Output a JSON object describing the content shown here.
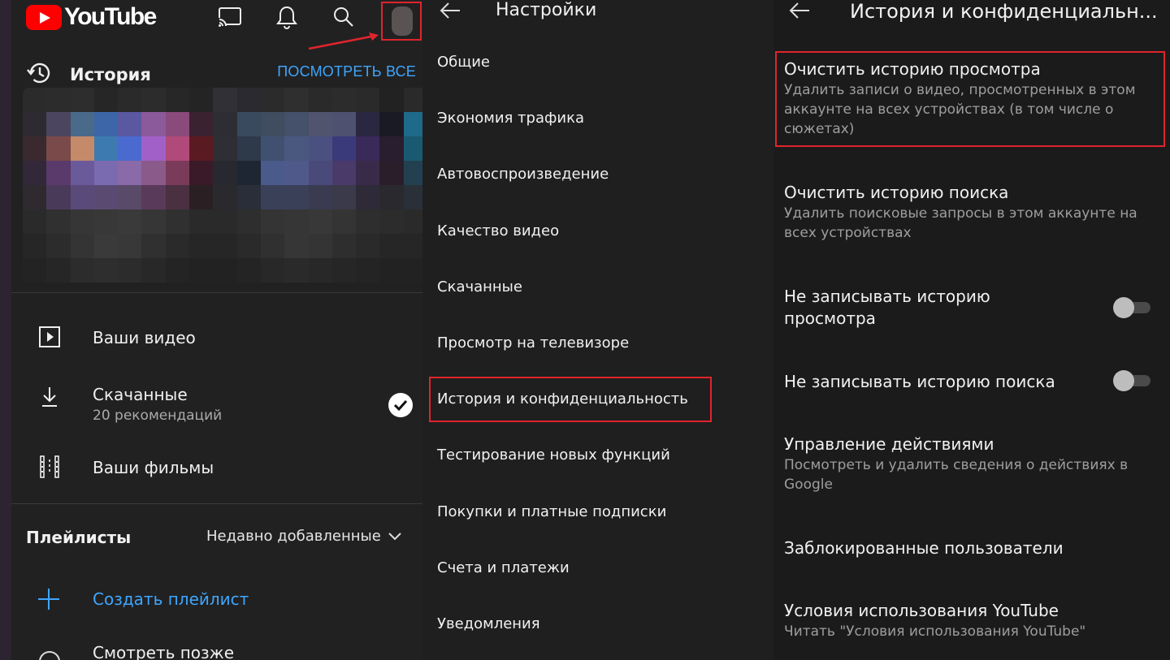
{
  "account_panel": {
    "logo_text": "YouTube",
    "icons": [
      "cast-icon",
      "bell-icon",
      "search-icon",
      "avatar"
    ],
    "history": {
      "title": "История",
      "view_all": "ПОСМОТРЕТЬ ВСЕ"
    },
    "menu": [
      {
        "label": "Ваши видео",
        "icon": "play-square-icon"
      },
      {
        "label": "Скачанные",
        "sub": "20 рекомендаций",
        "icon": "download-icon"
      },
      {
        "label": "Ваши фильмы",
        "icon": "film-strip-icon"
      }
    ],
    "playlists": {
      "title": "Плейлисты",
      "sort": "Недавно добавленные",
      "create": "Создать плейлист",
      "watch_later": "Смотреть позже"
    }
  },
  "settings_panel": {
    "title": "Настройки",
    "items": [
      "Общие",
      "Экономия трафика",
      "Автовоспроизведение",
      "Качество видео",
      "Скачанные",
      "Просмотр на телевизоре",
      "История и конфиденциальность",
      "Тестирование новых функций",
      "Покупки и платные подписки",
      "Счета и платежи",
      "Уведомления"
    ],
    "highlighted": "История и конфиденциальность"
  },
  "history_panel": {
    "title": "История и конфиденциальн...",
    "options": [
      {
        "title": "Очистить историю просмотра",
        "desc": "Удалить записи о видео, просмотренных в этом аккаунте на всех устройствах (в том числе о сюжетах)"
      },
      {
        "title": "Очистить историю поиска",
        "desc": "Удалить поисковые запросы в этом аккаунте на всех устройствах"
      },
      {
        "title": "Не записывать историю просмотра",
        "toggle": false
      },
      {
        "title": "Не записывать историю поиска",
        "toggle": false
      },
      {
        "title": "Управление действиями",
        "desc": "Посмотреть и удалить сведения о действиях в Google"
      },
      {
        "title": "Заблокированные пользователи"
      },
      {
        "title": "Условия использования YouTube",
        "desc": "Читать \"Условия использования YouTube\""
      }
    ]
  },
  "colors": {
    "accent_blue": "#3ea6ff",
    "highlight_red": "#e0242d",
    "yt_red": "#ff0000",
    "background": "#212121"
  }
}
